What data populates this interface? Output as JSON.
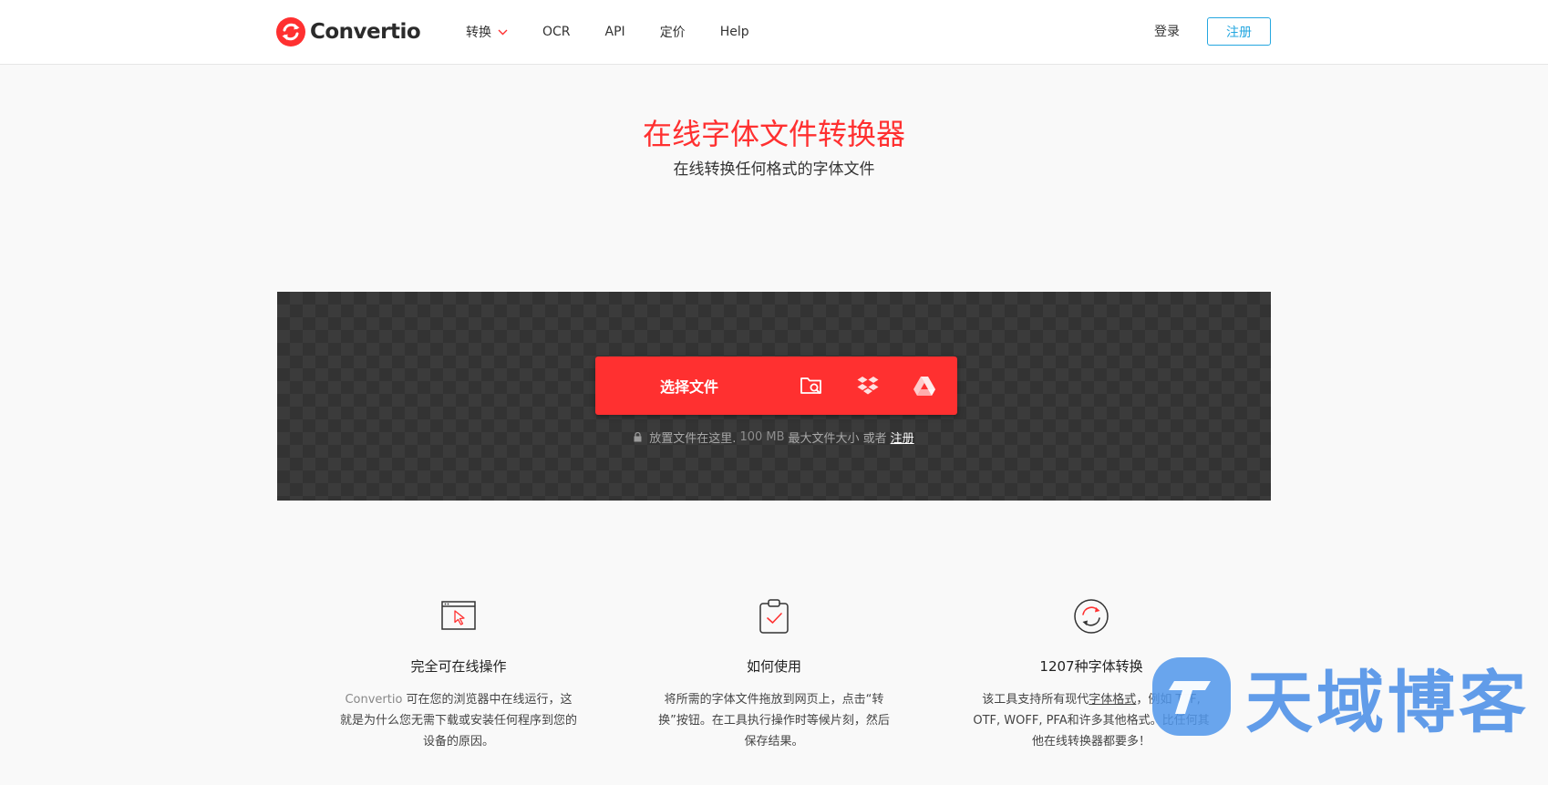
{
  "brand": {
    "name": "Convertio",
    "accent": "#ff3030",
    "link_blue": "#25a7e0"
  },
  "nav": {
    "items": [
      {
        "label": "转换",
        "has_dropdown": true
      },
      {
        "label": "OCR"
      },
      {
        "label": "API"
      },
      {
        "label": "定价"
      },
      {
        "label": "Help"
      }
    ],
    "login": "登录",
    "signup": "注册"
  },
  "hero": {
    "title": "在线字体文件转换器",
    "subtitle": "在线转换任何格式的字体文件"
  },
  "upload": {
    "choose_files": "选择文件",
    "sources": [
      "folder-search-icon",
      "dropbox-icon",
      "google-drive-icon"
    ],
    "hint_prefix": "放置文件在这里.",
    "hint_size": "100 MB",
    "hint_middle": "最大文件大小 或者",
    "hint_link": "注册"
  },
  "features": [
    {
      "icon": "browser-cursor-icon",
      "title": "完全可在线操作",
      "brand_word": "Convertio",
      "text": " 可在您的浏览器中在线运行，这就是为什么您无需下载或安装任何程序到您的设备的原因。"
    },
    {
      "icon": "clipboard-check-icon",
      "title": "如何使用",
      "text": "将所需的字体文件拖放到网页上，点击“转换”按钮。在工具执行操作时等候片刻，然后保存结果。"
    },
    {
      "icon": "refresh-circle-icon",
      "title": "1207种字体转换",
      "text_a": "该工具支持所有现代",
      "text_link": "字体格式",
      "text_b": "，例如 TTF, OTF, WOFF, PFA和许多其他格式。比任何其他在线转换器都要多！"
    }
  ],
  "watermark": {
    "text": "天域博客"
  }
}
